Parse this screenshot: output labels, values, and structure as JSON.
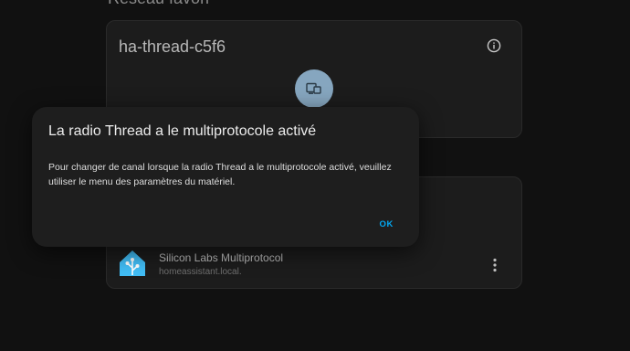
{
  "background": {
    "section_heading": "Réseau favori",
    "network_card": {
      "name": "ha-thread-c5f6",
      "info_icon": "info-icon",
      "router_icon": "router-device-icon"
    },
    "integration": {
      "title": "Silicon Labs Multiprotocol",
      "host": "homeassistant.local.",
      "logo": "home-assistant-logo",
      "menu_icon": "dots-vertical-icon"
    }
  },
  "dialog": {
    "title": "La radio Thread a le multiprotocole activé",
    "body": "Pour changer de canal lorsque la radio Thread a le multiprotocole activé, veuillez utiliser le menu des paramètres du matériel.",
    "ok_label": "OK"
  },
  "colors": {
    "page_bg": "#111111",
    "card_bg": "#1c1c1c",
    "dialog_bg": "#1e1e1e",
    "accent": "#03a9f4",
    "router_node": "#86a6bf",
    "ha_logo": "#41bdf5"
  }
}
